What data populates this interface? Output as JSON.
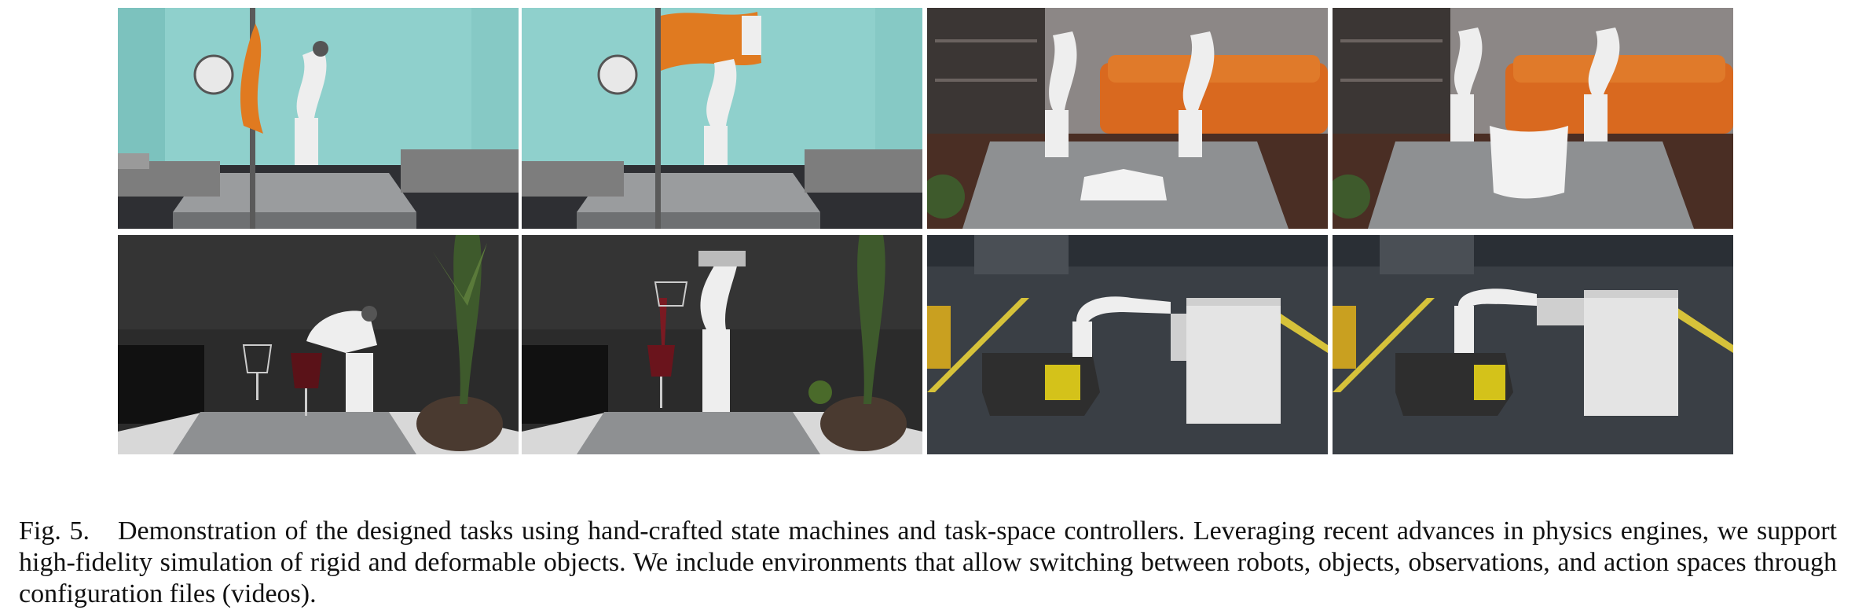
{
  "figure": {
    "panels": [
      {
        "row": 1,
        "col": 1,
        "scene": "teal room, robot arm and orange flag hanging on pole, grey sofas, wall clock"
      },
      {
        "row": 1,
        "col": 2,
        "scene": "teal room, robot arm waving orange flag on pole, grey sofas, wall clock"
      },
      {
        "row": 1,
        "col": 3,
        "scene": "living room with orange sofa and shelves, two robot arms above white t-shirt on table"
      },
      {
        "row": 1,
        "col": 4,
        "scene": "living room with orange sofa and shelves, two robot arms lifting white cloth"
      },
      {
        "row": 2,
        "col": 1,
        "scene": "dark room, robot arm holding wine glass next to empty glass, potted palm"
      },
      {
        "row": 2,
        "col": 2,
        "scene": "dark room, robot arm pouring red wine into glass, potted palm"
      },
      {
        "row": 2,
        "col": 3,
        "scene": "warehouse, mobile robot with arm approaching white cabinet"
      },
      {
        "row": 2,
        "col": 4,
        "scene": "warehouse, mobile robot with arm opening cabinet drawer"
      }
    ]
  },
  "caption": {
    "label": "Fig. 5.",
    "text": "Demonstration of the designed tasks using hand-crafted state machines and task-space controllers. Leveraging recent advances in physics engines, we support high-fidelity simulation of rigid and deformable objects. We include environments that allow switching between robots, objects, observations, and action spaces through configuration files (videos)."
  },
  "colors": {
    "teal_wall": "#8fd0cc",
    "orange_cloth": "#e07a20",
    "orange_sofa": "#d9691f",
    "dark_wall": "#2b2b2b",
    "warehouse_floor": "#3a3f45",
    "table_grey": "#8e9092",
    "robot_white": "#eeeeee"
  }
}
